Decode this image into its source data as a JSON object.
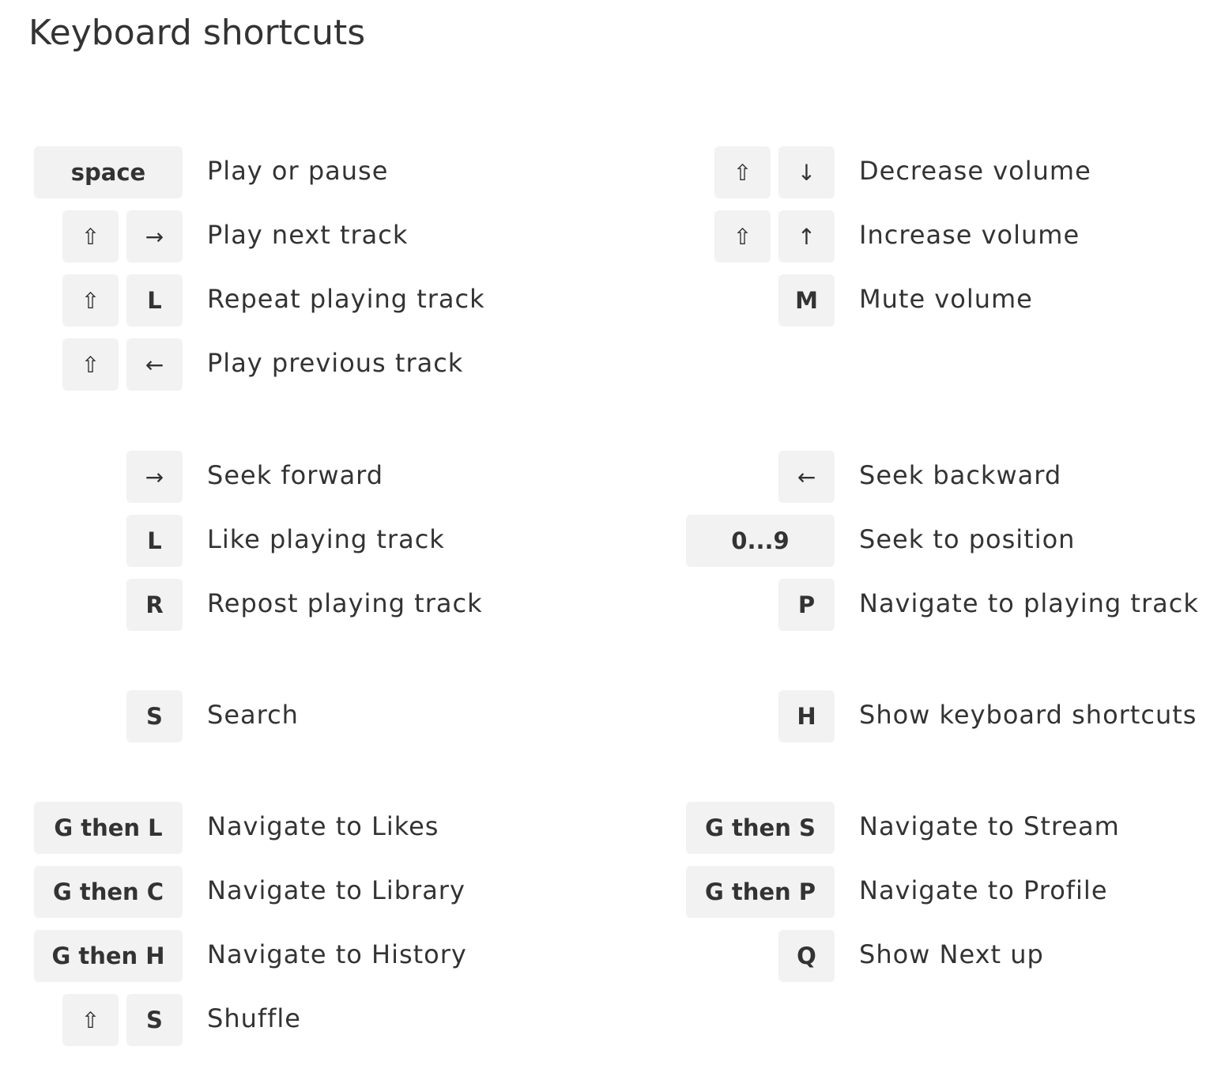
{
  "title": "Keyboard shortcuts",
  "shortcuts": [
    {
      "keys": [
        "space"
      ],
      "description": "Play or pause"
    },
    {
      "keys": [
        "⇧",
        "→"
      ],
      "description": "Play next track"
    },
    {
      "keys": [
        "⇧",
        "L"
      ],
      "description": "Repeat playing track"
    },
    {
      "keys": [
        "⇧",
        "←"
      ],
      "description": "Play previous track"
    },
    {
      "keys": [
        "→"
      ],
      "description": "Seek forward"
    },
    {
      "keys": [
        "L"
      ],
      "description": "Like playing track"
    },
    {
      "keys": [
        "R"
      ],
      "description": "Repost playing track"
    },
    {
      "keys": [
        "S"
      ],
      "description": "Search"
    },
    {
      "keys": [
        "G then L"
      ],
      "description": "Navigate to Likes"
    },
    {
      "keys": [
        "G then C"
      ],
      "description": "Navigate to Library"
    },
    {
      "keys": [
        "G then H"
      ],
      "description": "Navigate to History"
    },
    {
      "keys": [
        "⇧",
        "S"
      ],
      "description": "Shuffle"
    },
    {
      "keys": [
        "⇧",
        "↓"
      ],
      "description": "Decrease volume"
    },
    {
      "keys": [
        "⇧",
        "↑"
      ],
      "description": "Increase volume"
    },
    {
      "keys": [
        "M"
      ],
      "description": "Mute volume"
    },
    {
      "keys": [
        "←"
      ],
      "description": "Seek backward"
    },
    {
      "keys": [
        "0...9"
      ],
      "description": "Seek to position"
    },
    {
      "keys": [
        "P"
      ],
      "description": "Navigate to playing track"
    },
    {
      "keys": [
        "H"
      ],
      "description": "Show keyboard shortcuts"
    },
    {
      "keys": [
        "G then S"
      ],
      "description": "Navigate to Stream"
    },
    {
      "keys": [
        "G then P"
      ],
      "description": "Navigate to Profile"
    },
    {
      "keys": [
        "Q"
      ],
      "description": "Show Next up"
    }
  ]
}
